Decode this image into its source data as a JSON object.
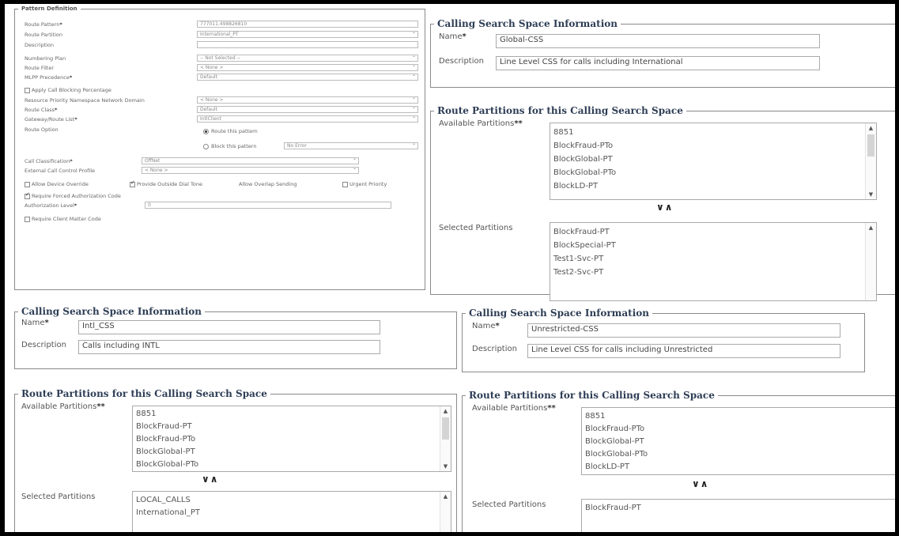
{
  "pattern_definition": {
    "legend": "Pattern Definition",
    "route_pattern": {
      "label": "Route Pattern",
      "value": "777011.498826810"
    },
    "route_partition": {
      "label": "Route Partition",
      "value": "International_PT"
    },
    "description": {
      "label": "Description",
      "value": ""
    },
    "numbering_plan": {
      "label": "Numbering Plan",
      "value": "-- Not Selected --"
    },
    "route_filter": {
      "label": "Route Filter",
      "value": "< None >"
    },
    "mlpp": {
      "label": "MLPP Precedence",
      "value": "Default"
    },
    "apply_call_blocking": "Apply Call Blocking Percentage",
    "resource_priority": {
      "label": "Resource Priority Namespace Network Domain",
      "value": "< None >"
    },
    "route_class": {
      "label": "Route Class",
      "value": "Default"
    },
    "gateway": {
      "label": "Gateway/Route List",
      "value": "IntlClient"
    },
    "route_option": {
      "label": "Route Option",
      "route_this": "Route this pattern",
      "block_this": "Block this pattern",
      "block_reason": "No Error"
    },
    "call_classification": {
      "label": "Call Classification",
      "value": "OffNet"
    },
    "external_call_control": {
      "label": "External Call Control Profile",
      "value": "< None >"
    },
    "allow_device_override": "Allow Device Override",
    "provide_outside_dial_tone": "Provide Outside Dial Tone",
    "allow_overlap_sending": "Allow Overlap Sending",
    "urgent_priority": "Urgent Priority",
    "require_fac": "Require Forced Authorization Code",
    "authorization_level": {
      "label": "Authorization Level",
      "value": "0"
    },
    "require_cmc": "Require Client Matter Code"
  },
  "css_global": {
    "info_legend": "Calling Search Space Information",
    "name_label": "Name",
    "name_value": "Global-CSS",
    "desc_label": "Description",
    "desc_value": "Line Level CSS for calls including International",
    "partitions_legend": "Route Partitions for this Calling Search Space",
    "available_label": "Available Partitions",
    "available": [
      "8851",
      "BlockFraud-PTo",
      "BlockGlobal-PT",
      "BlockGlobal-PTo",
      "BlockLD-PT"
    ],
    "selected_label": "Selected Partitions",
    "selected": [
      "BlockFraud-PT",
      "BlockSpecial-PT",
      "Test1-Svc-PT",
      "Test2-Svc-PT"
    ]
  },
  "css_intl": {
    "info_legend": "Calling Search Space Information",
    "name_label": "Name",
    "name_value": "Intl_CSS",
    "desc_label": "Description",
    "desc_value": "Calls including INTL",
    "partitions_legend": "Route Partitions for this Calling Search Space",
    "available_label": "Available Partitions",
    "available": [
      "8851",
      "BlockFraud-PT",
      "BlockFraud-PTo",
      "BlockGlobal-PT",
      "BlockGlobal-PTo"
    ],
    "selected_label": "Selected Partitions",
    "selected": [
      "LOCAL_CALLS",
      "International_PT"
    ]
  },
  "css_unrestricted": {
    "info_legend": "Calling Search Space Information",
    "name_label": "Name",
    "name_value": "Unrestricted-CSS",
    "desc_label": "Description",
    "desc_value": "Line Level CSS for calls including Unrestricted",
    "partitions_legend": "Route Partitions for this Calling Search Space",
    "available_label": "Available Partitions",
    "available": [
      "8851",
      "BlockFraud-PTo",
      "BlockGlobal-PT",
      "BlockGlobal-PTo",
      "BlockLD-PT"
    ],
    "selected_label": "Selected Partitions",
    "selected": [
      "BlockFraud-PT"
    ]
  },
  "move_arrows": "∨∧",
  "required_marker": "*",
  "double_required_marker": "**"
}
